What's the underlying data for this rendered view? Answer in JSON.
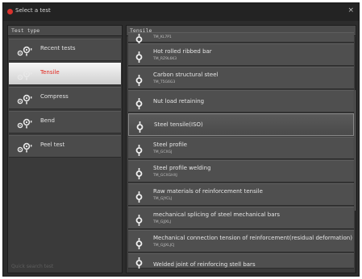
{
  "window": {
    "title": "Select a test",
    "close_glyph": "×",
    "accent": "#d9322d"
  },
  "left_panel": {
    "header": "Test type",
    "search_placeholder": "Quick search test",
    "categories": [
      {
        "label": "Recent tests",
        "icon": "sensor-pair-icon",
        "selected": false
      },
      {
        "label": "Tensile",
        "icon": "sensor-pair-icon",
        "selected": true
      },
      {
        "label": "Compress",
        "icon": "sensor-pair-icon",
        "selected": false
      },
      {
        "label": "Bend",
        "icon": "sensor-pair-icon",
        "selected": false
      },
      {
        "label": "Peel test",
        "icon": "sensor-pair-icon",
        "selected": false
      }
    ]
  },
  "right_panel": {
    "header": "Tensile",
    "tests": [
      {
        "name": "",
        "code": "TM_KL7P1"
      },
      {
        "name": "Hot rolled ribbed bar",
        "code": "TM_RZ9L6K3"
      },
      {
        "name": "Carbon structural steel",
        "code": "TM_T5G6G3"
      },
      {
        "name": "Nut load retaining",
        "code": ""
      },
      {
        "name": "Steel tensile(ISO)",
        "code": ""
      },
      {
        "name": "Steel profile",
        "code": "TM_GCXGJ"
      },
      {
        "name": "Steel profile welding",
        "code": "TM_GCXGHXJ"
      },
      {
        "name": "Raw materials of reinforcement tensile",
        "code": "TM_GJYCLJ"
      },
      {
        "name": "mechanical splicing of steel mechanical bars",
        "code": "TM_GJJXLJ"
      },
      {
        "name": "Mechanical connection tension of reinforcement(residual deformation)",
        "code": "TM_GJJXLJCJ"
      },
      {
        "name": "Welded joint of reinforcing stell bars",
        "code": ""
      }
    ]
  }
}
